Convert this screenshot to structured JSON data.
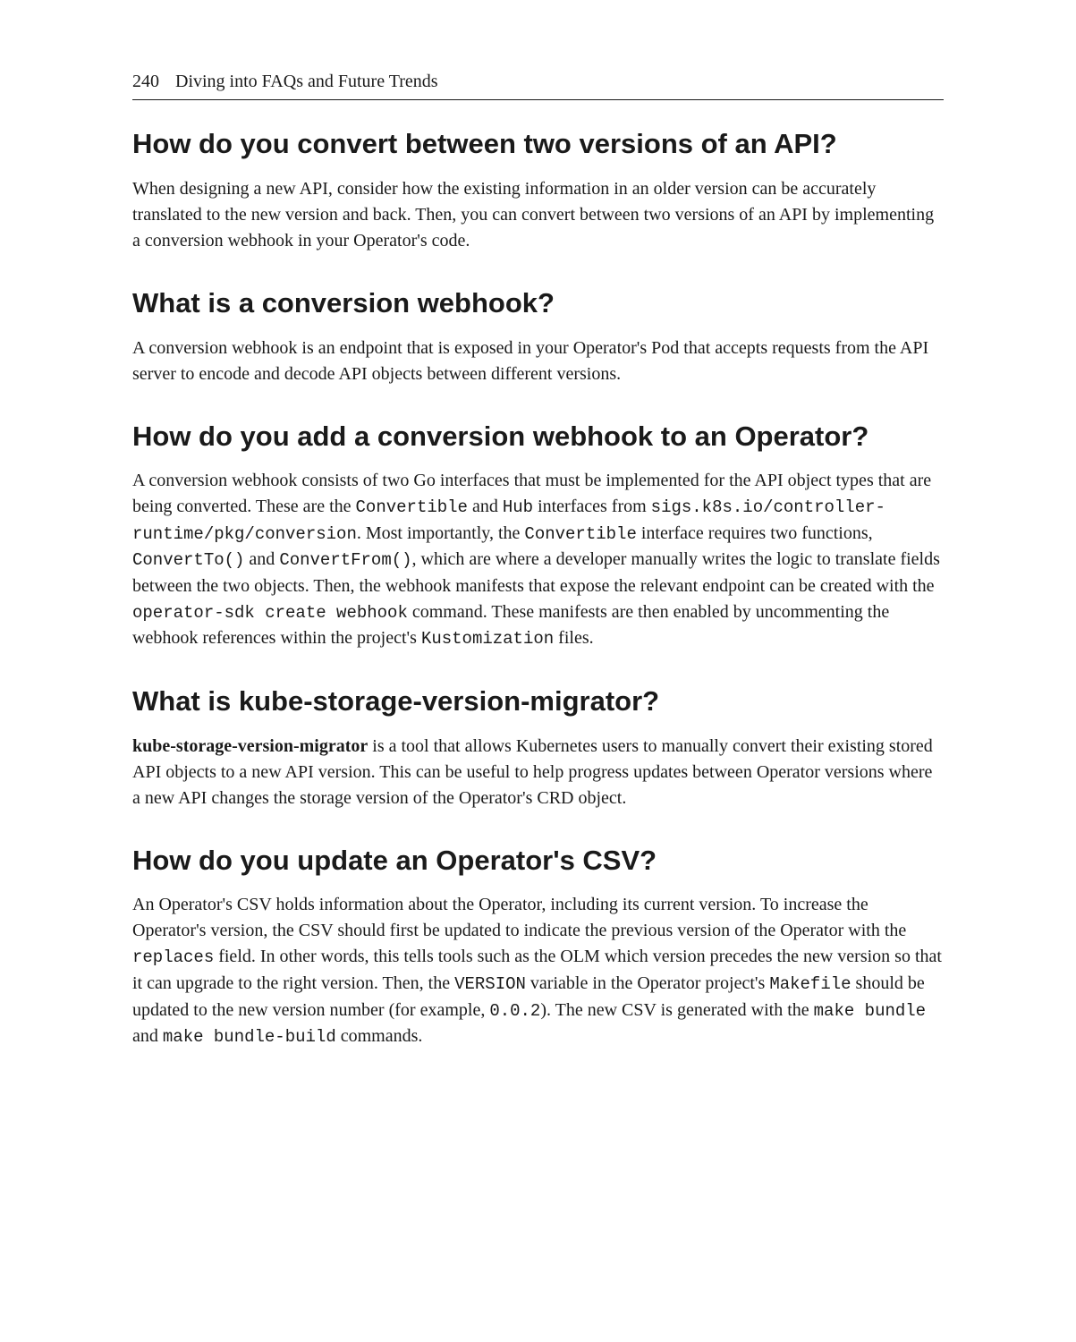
{
  "header": {
    "page_number": "240",
    "chapter_title": "Diving into FAQs and Future Trends"
  },
  "sections": {
    "s1": {
      "heading": "How do you convert between two versions of an API?",
      "p1": "When designing a new API, consider how the existing information in an older version can be accurately translated to the new version and back. Then, you can convert between two versions of an API by implementing a conversion webhook in your Operator's code."
    },
    "s2": {
      "heading": "What is a conversion webhook?",
      "p1": "A conversion webhook is an endpoint that is exposed in your Operator's Pod that accepts requests from the API server to encode and decode API objects between different versions."
    },
    "s3": {
      "heading": "How do you add a conversion webhook to an Operator?",
      "p1a": "A conversion webhook consists of two Go interfaces that must be implemented for the API object types that are being converted. These are the ",
      "c1": "Convertible",
      "p1b": " and ",
      "c2": "Hub",
      "p1c": " interfaces from ",
      "c3": "sigs.k8s.io/controller-runtime/pkg/conversion",
      "p1d": ". Most importantly, the ",
      "c4": "Convertible",
      "p1e": " interface requires two functions, ",
      "c5": "ConvertTo()",
      "p1f": " and ",
      "c6": "ConvertFrom()",
      "p1g": ", which are where a developer manually writes the logic to translate fields between the two objects. Then, the webhook manifests that expose the relevant endpoint can be created with the ",
      "c7": "operator-sdk create webhook",
      "p1h": " command. These manifests are then enabled by uncommenting the webhook references within the project's ",
      "c8": "Kustomization",
      "p1i": " files."
    },
    "s4": {
      "heading": "What is kube-storage-version-migrator?",
      "b1": "kube-storage-version-migrator",
      "p1": " is a tool that allows Kubernetes users to manually convert their existing stored API objects to a new API version. This can be useful to help progress updates between Operator versions where a new API changes the storage version of the Operator's CRD object."
    },
    "s5": {
      "heading": "How do you update an Operator's CSV?",
      "p1a": "An Operator's CSV holds information about the Operator, including its current version. To increase the Operator's version, the CSV should first be updated to indicate the previous version of the Operator with the ",
      "c1": "replaces",
      "p1b": " field. In other words, this tells tools such as the OLM which version precedes the new version so that it can upgrade to the right version. Then, the ",
      "c2": "VERSION",
      "p1c": " variable in the Operator project's ",
      "c3": "Makefile",
      "p1d": " should be updated to the new version number (for example, ",
      "c4": "0.0.2",
      "p1e": "). The new CSV is generated with the ",
      "c5": "make bundle",
      "p1f": " and ",
      "c6": "make bundle-build",
      "p1g": " commands."
    }
  }
}
